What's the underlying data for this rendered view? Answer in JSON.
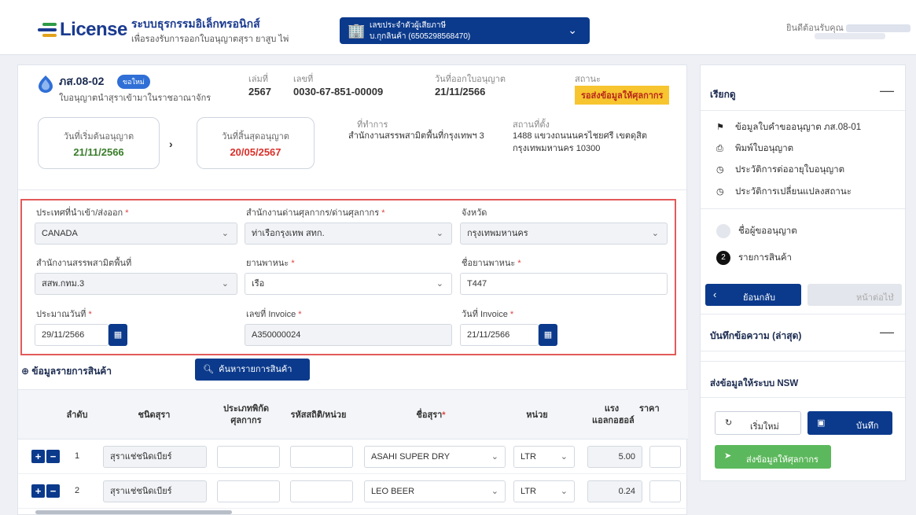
{
  "header": {
    "logo_text": "License",
    "system_title": "ระบบธุรกรรมอิเล็กทรอนิกส์",
    "system_subtitle": "เพื่อรองรับการออกใบอนุญาตสุรา ยาสูบ ไพ่",
    "license_box_line1": "เลขประจำตัวผู้เสียภาษี",
    "license_box_line2": "บ.กุกลินค้า (6505298568470)",
    "welcome_text": "ยินดีต้อนรับคุณ"
  },
  "document": {
    "code": "ภส.08-02",
    "badge": "ขอใหม่",
    "type": "ใบอนุญาตนำสุราเข้ามาในราชอาณาจักร",
    "book_label": "เล่มที่",
    "book_value": "2567",
    "number_label": "เลขที่",
    "number_value": "0030-67-851-00009",
    "issue_label": "วันที่ออกใบอนุญาต",
    "issue_value": "21/11/2566",
    "status_label": "สถานะ",
    "status_value": "รอส่งข้อมูลให้ศุลกากร",
    "start_label": "วันที่เริ่มต้นอนุญาต",
    "start_value": "21/11/2566",
    "end_label": "วันที่สิ้นสุดอนุญาต",
    "end_value": "20/05/2567",
    "office_label": "ที่ทำการ",
    "office_value": "สำนักงานสรรพสามิตพื้นที่กรุงเทพฯ 3",
    "location_label": "สถานที่ตั้ง",
    "location_line1": "1488 แขวงถนนนครไชยศรี เขตดุสิต",
    "location_line2": "กรุงเทพมหานคร 10300"
  },
  "form": {
    "country_label": "ประเทศที่นำเข้า/ส่งออก",
    "country_value": "CANADA",
    "customs_label": "สำนักงานด่านศุลกากร/ด่านศุลกากร",
    "customs_value": "ท่าเรือกรุงเทพ สทก.",
    "province_label": "จังหวัด",
    "province_value": "กรุงเทพมหานคร",
    "excise_label": "สำนักงานสรรพสามิตพื้นที่",
    "excise_value": "สสพ.กทม.3",
    "vehicle_label": "ยานพาหนะ",
    "vehicle_value": "เรือ",
    "vehicle_name_label": "ชื่อยานพาหนะ",
    "vehicle_name_value": "T447",
    "est_date_label": "ประมาณวันที่",
    "est_date_value": "29/11/2566",
    "invoice_label": "เลขที่ Invoice",
    "invoice_value": "A350000024",
    "invoice_date_label": "วันที่ Invoice",
    "invoice_date_value": "21/11/2566",
    "required_mark": "*"
  },
  "products": {
    "section_title": "ข้อมูลรายการสินค้า",
    "search_button": "ค้นหารายการสินค้า",
    "columns": [
      "ลำดับ",
      "ชนิดสุรา",
      "ประเภทพิกัดศุลกากร",
      "รหัสสถิติ/หน่วย",
      "ชื่อสุรา",
      "หน่วย",
      "แรงแอลกอฮอล์",
      "ราคา"
    ],
    "rows": [
      {
        "no": "1",
        "type": "สุราแช่ชนิดเบียร์",
        "name": "ASAHI SUPER DRY",
        "unit": "LTR",
        "alcohol": "5.00"
      },
      {
        "no": "2",
        "type": "สุราแช่ชนิดเบียร์",
        "name": "LEO BEER",
        "unit": "LTR",
        "alcohol": "0.24"
      }
    ]
  },
  "sidebar": {
    "menu_title": "เรียกดู",
    "menu_items": [
      "ข้อมูลใบคำขออนุญาต ภส.08-01",
      "พิมพ์ใบอนุญาต",
      "ประวัติการต่ออายุใบอนุญาต",
      "ประวัติการเปลี่ยนแปลงสถานะ"
    ],
    "step1": "ชื่อผู้ขออนุญาต",
    "step2": "รายการสินค้า",
    "step2_num": "2",
    "back_button": "ย้อนกลับ",
    "next_button": "หน้าต่อไป",
    "notes_title": "บันทึกข้อความ (ล่าสุด)",
    "nsw_title": "ส่งข้อมูลให้ระบบ NSW",
    "restart_button": "เริ่มใหม่",
    "save_button": "บันทึก",
    "send_button": "ส่งข้อมูลให้ศุลกากร"
  },
  "colors": {
    "primary": "#0b3a8c",
    "accent_red": "#e35a5a",
    "status_yellow": "#f7c52f",
    "end_date_red": "#d9302a",
    "start_date_green": "#3a7d2a",
    "send_green": "#5cb85c"
  }
}
